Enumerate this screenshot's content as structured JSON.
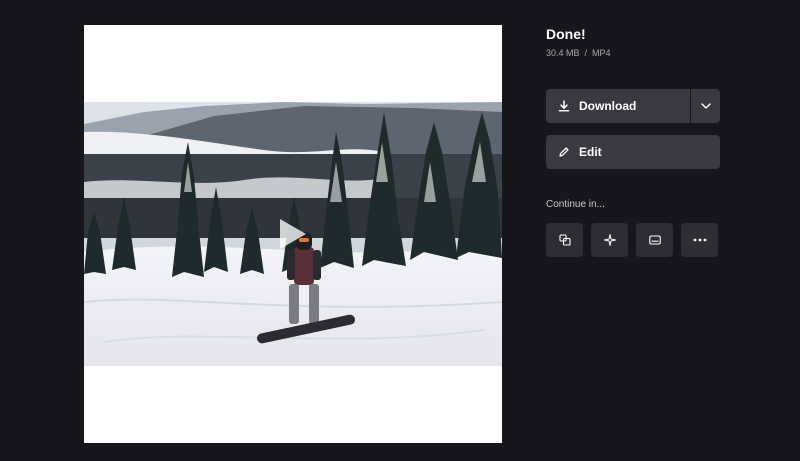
{
  "status": {
    "title": "Done!",
    "file_size": "30.4 MB",
    "separator": "/",
    "format": "MP4"
  },
  "actions": {
    "download_label": "Download",
    "edit_label": "Edit"
  },
  "continue_in": {
    "label": "Continue in...",
    "tools": [
      {
        "icon": "resize-icon"
      },
      {
        "icon": "sparkle-icon"
      },
      {
        "icon": "subtitles-icon"
      },
      {
        "icon": "more-icon"
      }
    ]
  },
  "colors": {
    "background": "#17161b",
    "button": "#3a3940",
    "tool_button": "#2e2d33",
    "text_muted": "#a8a7ad"
  }
}
